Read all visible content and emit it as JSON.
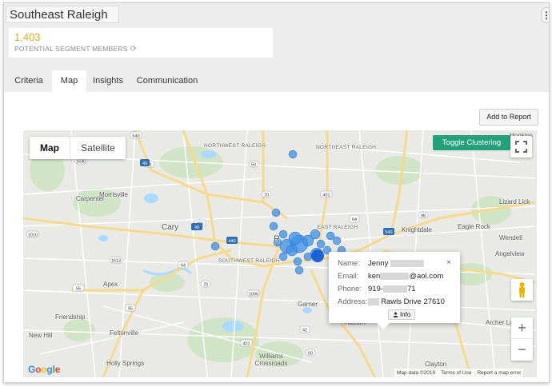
{
  "segment": {
    "title": "Southeast Raleigh",
    "menu_glyph": "⋮"
  },
  "stats": {
    "count": "1,403",
    "label": "POTENTIAL SEGMENT MEMBERS",
    "refresh_glyph": "⟳"
  },
  "tabs": [
    {
      "label": "Criteria",
      "active": false
    },
    {
      "label": "Map",
      "active": true
    },
    {
      "label": "Insights",
      "active": false
    },
    {
      "label": "Communication",
      "active": false
    }
  ],
  "toolbar": {
    "add_to_report": "Add to Report"
  },
  "map": {
    "type_map": "Map",
    "type_satellite": "Satellite",
    "toggle_clustering": "Toggle Clustering",
    "zoom_in": "+",
    "zoom_out": "−",
    "google": [
      "G",
      "o",
      "o",
      "g",
      "l",
      "e"
    ],
    "google_colors": [
      "#4285f4",
      "#ea4335",
      "#fbbc05",
      "#4285f4",
      "#34a853",
      "#ea4335"
    ],
    "attribution": {
      "data": "Map data ©2019",
      "terms": "Terms of Use",
      "report": "Report a map error"
    },
    "places": [
      "Morrisville",
      "Carpenter",
      "Cary",
      "Apex",
      "Friendship",
      "New Hill",
      "Feltonville",
      "Holly Springs",
      "Garner",
      "Knightdale",
      "Eagle Rock",
      "Wendell",
      "Angelview",
      "Archer Lodge",
      "Auburn",
      "Williams Crossroads",
      "Clayton",
      "Hopkins",
      "Lizard Lick",
      "R"
    ],
    "districts": [
      "NORTHWEST RALEIGH",
      "NORTHEAST RALEIGH",
      "EAST RALEIGH",
      "SOUTHWEST RALEIGH"
    ],
    "shields": [
      "540",
      "1630",
      "54",
      "40",
      "70",
      "401",
      "50",
      "440",
      "64",
      "98",
      "540",
      "1613",
      "55",
      "1010",
      "42",
      "401",
      "50",
      "70",
      "1006",
      "42",
      "401",
      "64",
      "40",
      "55"
    ]
  },
  "infowindow": {
    "name_key": "Name:",
    "name_val": "Jenny",
    "email_key": "Email:",
    "email_pre": "ken",
    "email_post": "@aol.com",
    "phone_key": "Phone:",
    "phone_pre": "919-",
    "phone_post": "71",
    "address_key": "Address:",
    "address_val": "Rawls Drive 27610",
    "close": "×",
    "info_label": "Info",
    "user_icon_glyph": "👤"
  },
  "colors": {
    "accent": "#f2a31b",
    "green": "#22a27a",
    "marker": "#3b8fe6"
  }
}
